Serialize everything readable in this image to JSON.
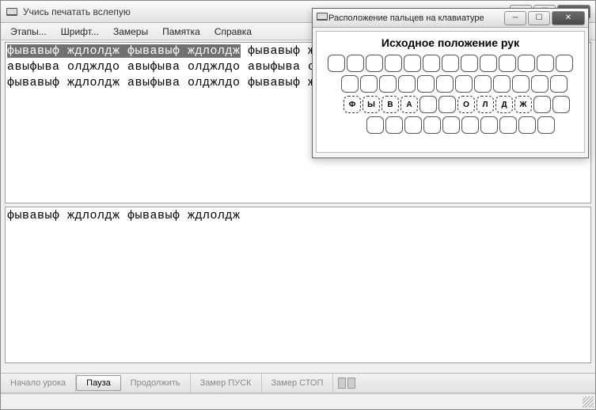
{
  "main": {
    "title": "Учись печатать вслепую",
    "menu": [
      "Этапы...",
      "Шрифт...",
      "Замеры",
      "Памятка",
      "Справка"
    ],
    "exercise_done": "фывавыф ждлолдж фывавыф ждлолдж",
    "exercise_rest_line1": " фывавыф ждлолдж фывавыф ждлолдж",
    "exercise_line2": "авыфыва олджлдо авыфыва олджлдо авыфыва олджлдо авыфыва олджлдо",
    "exercise_line3": "фывавыф ждлолдж авыфыва олджлдо фывавыф ждлолдж авыфыва олджлдо",
    "typed": "фывавыф ждлолдж фывавыф ждлолдж",
    "toolbar": {
      "start": "Начало урока",
      "pause": "Пауза",
      "continue": "Продолжить",
      "measure_start": "Замер ПУСК",
      "measure_stop": "Замер СТОП"
    }
  },
  "sub": {
    "title": "Расположение пальцев на клавиатуре",
    "heading": "Исходное положение рук",
    "home_left": [
      "Ф",
      "Ы",
      "В",
      "А"
    ],
    "home_right": [
      "О",
      "Л",
      "Д",
      "Ж"
    ]
  }
}
